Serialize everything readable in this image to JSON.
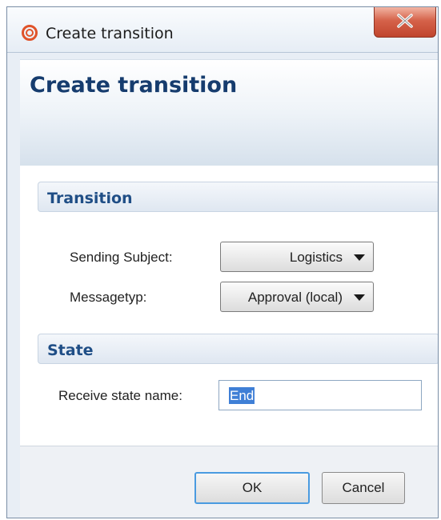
{
  "window": {
    "title": "Create transition",
    "app_icon": "app-logo-icon",
    "close_icon": "close-icon"
  },
  "header": {
    "title": "Create transition"
  },
  "sections": {
    "transition": {
      "title": "Transition",
      "sending_subject_label": "Sending Subject:",
      "sending_subject_value": "Logistics",
      "messagetyp_label": "Messagetyp:",
      "messagetyp_value": "Approval (local)"
    },
    "state": {
      "title": "State",
      "receive_state_label": "Receive state name:",
      "receive_state_value": "End"
    }
  },
  "footer": {
    "ok_label": "OK",
    "cancel_label": "Cancel"
  },
  "colors": {
    "header_title": "#163c6e",
    "section_title": "#1f4e86",
    "close_button": "#c0452d",
    "selection": "#3f7fd6",
    "ok_focus_border": "#4a9be0"
  }
}
